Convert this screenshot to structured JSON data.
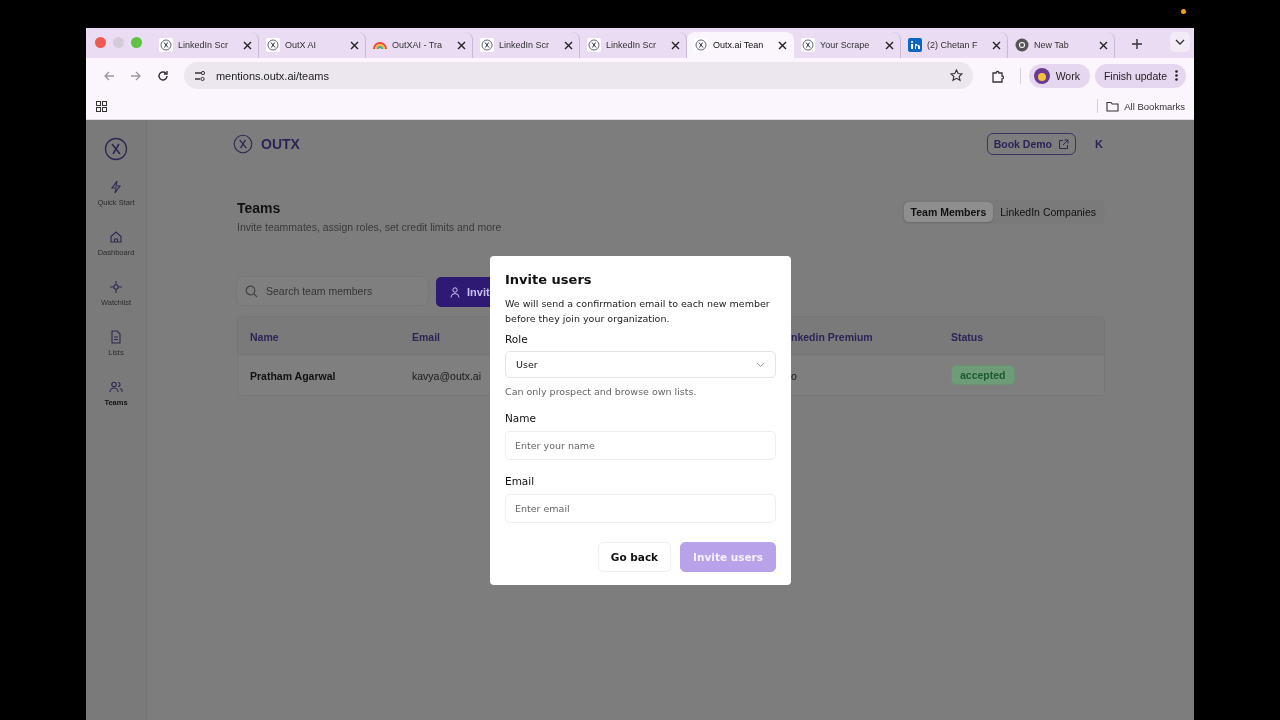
{
  "browser": {
    "tabs": [
      {
        "title": "LinkedIn Scr",
        "kind": "outx",
        "selected": false
      },
      {
        "title": "OutX AI",
        "kind": "outx",
        "selected": false
      },
      {
        "title": "OutXAI - Tra",
        "kind": "rainbow",
        "selected": false
      },
      {
        "title": "LinkedIn Scr",
        "kind": "outx",
        "selected": false
      },
      {
        "title": "LinkedIn Scr",
        "kind": "outx",
        "selected": false
      },
      {
        "title": "Outx.ai Tean",
        "kind": "outx",
        "selected": true
      },
      {
        "title": "Your Scrape",
        "kind": "outx",
        "selected": false
      },
      {
        "title": "(2) Chetan F",
        "kind": "linkedin",
        "selected": false
      },
      {
        "title": "New Tab",
        "kind": "chrome",
        "selected": false
      }
    ],
    "address": "mentions.outx.ai/teams",
    "profile": "Work",
    "update_button": "Finish update",
    "bookmarks_folder": "All Bookmarks"
  },
  "sidebar": {
    "items": [
      {
        "label": "Quick Start",
        "kind": "bolt",
        "selected": false
      },
      {
        "label": "Dashboard",
        "kind": "home",
        "selected": false
      },
      {
        "label": "Watchlist",
        "kind": "target",
        "selected": false
      },
      {
        "label": "Lists",
        "kind": "doc",
        "selected": false
      },
      {
        "label": "Teams",
        "kind": "users",
        "selected": true
      }
    ]
  },
  "header": {
    "brand": "OUTX",
    "book_demo": "Book Demo",
    "avatar": "K"
  },
  "page": {
    "title": "Teams",
    "subtitle": "Invite teammates, assign roles, set credit limits and more",
    "segments": [
      {
        "label": "Team Members",
        "selected": true
      },
      {
        "label": "LinkedIn Companies",
        "selected": false
      }
    ],
    "search": {
      "placeholder": "Search team members"
    },
    "invite_button": "Invit"
  },
  "table": {
    "columns": [
      "Name",
      "Email",
      "nkedin Premium",
      "Status"
    ],
    "rows": [
      {
        "cells": [
          "Pratham Agarwal",
          "kavya@outx.ai",
          "o",
          "accepted"
        ]
      }
    ]
  },
  "dialog": {
    "title": "Invite users",
    "description": "We will send a confirmation email to each new member before they join your organization.",
    "role": {
      "label": "Role",
      "value": "User",
      "hint": "Can only prospect and browse own lists."
    },
    "name": {
      "label": "Name",
      "placeholder": "Enter your name"
    },
    "email": {
      "label": "Email",
      "placeholder": "Enter email"
    },
    "buttons": [
      {
        "label": "Go back",
        "kind": "secondary",
        "disabled": false
      },
      {
        "label": "Invite users",
        "kind": "primary",
        "disabled": true
      }
    ]
  }
}
